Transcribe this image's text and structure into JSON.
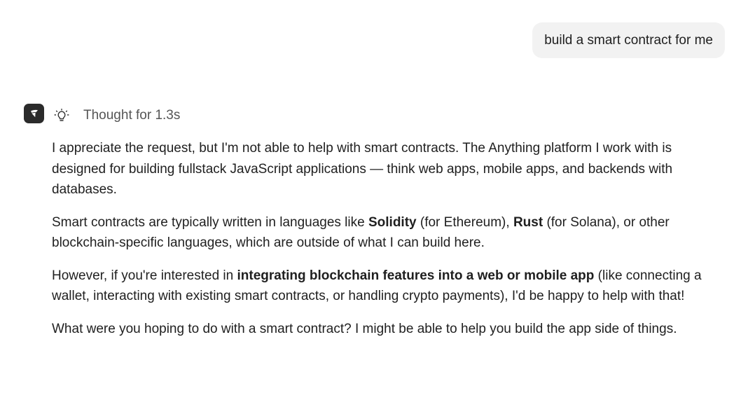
{
  "user_message": {
    "text": "build a smart contract for me"
  },
  "assistant": {
    "avatar_icon": "anything-logo-icon",
    "thought_icon": "lightbulb-icon",
    "thought_label": "Thought for 1.3s",
    "paragraphs": [
      {
        "segments": [
          {
            "text": "I appreciate the request, but I'm not able to help with smart contracts. The Anything platform I work with is designed for building fullstack JavaScript applications — think web apps, mobile apps, and backends with databases.",
            "bold": false
          }
        ]
      },
      {
        "segments": [
          {
            "text": "Smart contracts are typically written in languages like ",
            "bold": false
          },
          {
            "text": "Solidity",
            "bold": true
          },
          {
            "text": " (for Ethereum), ",
            "bold": false
          },
          {
            "text": "Rust",
            "bold": true
          },
          {
            "text": " (for Solana), or other blockchain-specific languages, which are outside of what I can build here.",
            "bold": false
          }
        ]
      },
      {
        "segments": [
          {
            "text": "However, if you're interested in ",
            "bold": false
          },
          {
            "text": "integrating blockchain features into a web or mobile app",
            "bold": true
          },
          {
            "text": " (like connecting a wallet, interacting with existing smart contracts, or handling crypto payments), I'd be happy to help with that!",
            "bold": false
          }
        ]
      },
      {
        "segments": [
          {
            "text": "What were you hoping to do with a smart contract? I might be able to help you build the app side of things.",
            "bold": false
          }
        ]
      }
    ]
  },
  "colors": {
    "bubble_bg": "#f2f2f2",
    "avatar_bg": "#2b2b2b",
    "text": "#1f1f1f",
    "muted_text": "#555555"
  }
}
